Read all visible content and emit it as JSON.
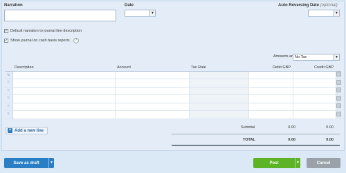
{
  "header": {
    "narration_label": "Narration",
    "date_label": "Date",
    "auto_reversing_label": "Auto Reversing Date",
    "auto_reversing_optional": "(optional)"
  },
  "options": {
    "default_narration": "Default narration to journal line description",
    "show_cash_basis": "Show journal on cash basis reports",
    "help_glyph": "?"
  },
  "amounts": {
    "label": "Amounts are",
    "selected": "No Tax"
  },
  "table": {
    "columns": [
      "Description",
      "Account",
      "Tax Rate",
      "Debit GBP",
      "Credit GBP"
    ],
    "row_count": 6
  },
  "add_line_label": "Add a new line",
  "totals": {
    "subtotal_label": "Subtotal",
    "subtotal_debit": "0.00",
    "subtotal_credit": "0.00",
    "total_label": "TOTAL",
    "total_debit": "0.00",
    "total_credit": "0.00"
  },
  "footer": {
    "save_draft_label": "Save as draft",
    "post_label": "Post",
    "cancel_label": "Cancel"
  },
  "colors": {
    "save_blue": "#2a7fc4",
    "post_green": "#5cb326",
    "cancel_grey": "#9aa1a8"
  },
  "icons": {
    "drag_handle": "drag-handle-icon",
    "sort": "sort-arrows-icon",
    "dropdown": "chevron-down-icon",
    "delete": "delete-row-icon"
  }
}
